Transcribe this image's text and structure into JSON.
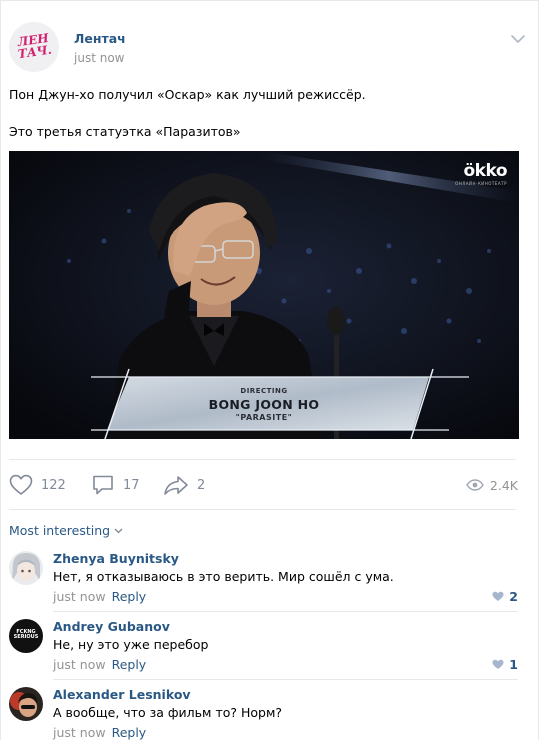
{
  "post": {
    "group_name": "Лентач",
    "logo_text": "ЛЕН\nТАЧ.",
    "time": "just now",
    "text_line1": "Пон Джун-хо получил «Оскар» как лучший режиссёр.",
    "text_line2": "Это третья статуэтка «Паразитов»",
    "media": {
      "watermark": "ökko",
      "watermark_sub": "ОНЛАЙН-КИНОТЕАТР",
      "caption_role": "DIRECTING",
      "caption_name": "BONG JOON HO",
      "caption_film": "\"PARASITE\""
    }
  },
  "actions": {
    "likes": "122",
    "comments": "17",
    "shares": "2",
    "views": "2.4K"
  },
  "comments_sort": "Most interesting",
  "comments": [
    {
      "author": "Zhenya Buynitsky",
      "text": "Нет, я отказываюсь в это верить. Мир сошёл с ума.",
      "time": "just now",
      "reply": "Reply",
      "likes": "2"
    },
    {
      "author": "Andrey Gubanov",
      "text": "Не, ну это уже перебор",
      "time": "just now",
      "reply": "Reply",
      "likes": "1",
      "avatar_text": "FCKNG SERIOUS"
    },
    {
      "author": "Alexander Lesnikov",
      "text": "А вообще, что за фильм то? Норм?",
      "time": "just now",
      "reply": "Reply",
      "likes": ""
    }
  ],
  "colors": {
    "link": "#2a5885",
    "muted": "#939393",
    "icon": "#828a99",
    "brand": "#d1206f"
  }
}
